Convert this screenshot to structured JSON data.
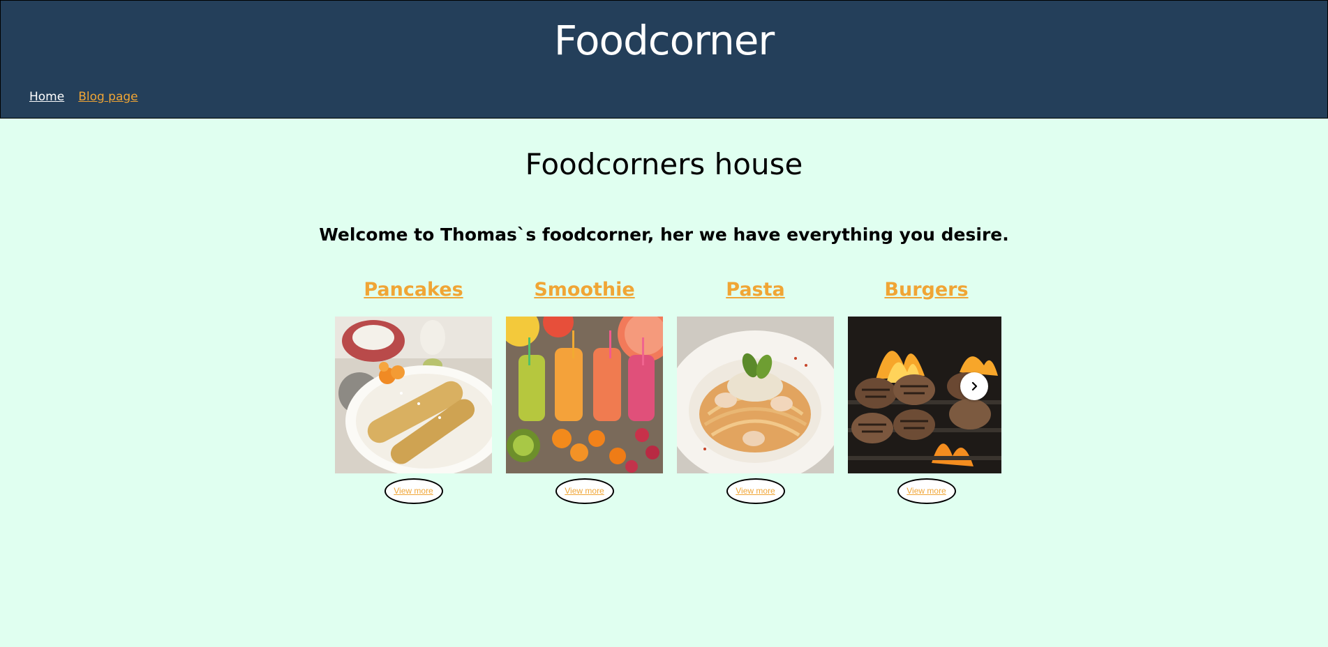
{
  "header": {
    "title": "Foodcorner",
    "nav": {
      "home": "Home",
      "blog": "Blog page"
    }
  },
  "main": {
    "heading": "Foodcorners house",
    "welcome": "Welcome to Thomas`s foodcorner, her we have everything you desire.",
    "cards": [
      {
        "title": "Pancakes",
        "button": "View more",
        "image": "pancakes-photo"
      },
      {
        "title": "Smoothie",
        "button": "View more",
        "image": "smoothie-photo"
      },
      {
        "title": "Pasta",
        "button": "View more",
        "image": "pasta-photo"
      },
      {
        "title": "Burgers",
        "button": "View more",
        "image": "burgers-photo"
      }
    ],
    "carousel_next_icon": "chevron-right-icon"
  },
  "colors": {
    "header_bg": "#243f5a",
    "page_bg": "#e0fff0",
    "link_accent": "#f0a535",
    "nav_home": "#ffffff"
  }
}
